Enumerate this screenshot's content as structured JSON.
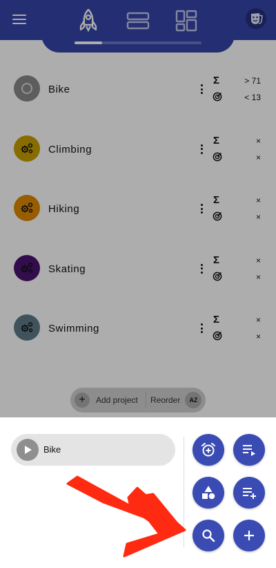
{
  "colors": {
    "primary": "#3545a9",
    "fab": "#3a4cb4",
    "annotation": "#ff2a12"
  },
  "topbar": {
    "menu_icon": "hamburger-menu-icon",
    "tabs": [
      {
        "icon": "rocket-icon",
        "active": true
      },
      {
        "icon": "rows-layout-icon",
        "active": false
      },
      {
        "icon": "dashboard-grid-icon",
        "active": false
      }
    ],
    "profile_icon": "theater-mask-icon",
    "tab_progress": 0.22
  },
  "projects": [
    {
      "name": "Bike",
      "icon": "circle-icon",
      "color": "#8a8a8a",
      "sum": "> 71",
      "goal": "< 13"
    },
    {
      "name": "Climbing",
      "icon": "gears-icon",
      "color": "#c9a000",
      "sum": "×",
      "goal": "×"
    },
    {
      "name": "Hiking",
      "icon": "gears-icon",
      "color": "#e08a00",
      "sum": "×",
      "goal": "×"
    },
    {
      "name": "Skating",
      "icon": "gears-icon",
      "color": "#4a1470",
      "sum": "×",
      "goal": "×"
    },
    {
      "name": "Swimming",
      "icon": "gears-icon",
      "color": "#5f7b88",
      "sum": "×",
      "goal": "×"
    }
  ],
  "stat_labels": {
    "sum_symbol": "Σ",
    "goal_icon": "target-icon"
  },
  "list_actions": {
    "add_label": "Add project",
    "add_icon": "plus-icon",
    "reorder_label": "Reorder",
    "az_label": "AZ"
  },
  "sheet": {
    "active_project": "Bike",
    "play_icon": "play-icon",
    "fabs": [
      {
        "icon": "alarm-add-icon"
      },
      {
        "icon": "playlist-play-icon"
      },
      {
        "icon": "shapes-icon"
      },
      {
        "icon": "playlist-add-icon"
      },
      {
        "icon": "search-icon"
      },
      {
        "icon": "add-icon"
      }
    ]
  }
}
